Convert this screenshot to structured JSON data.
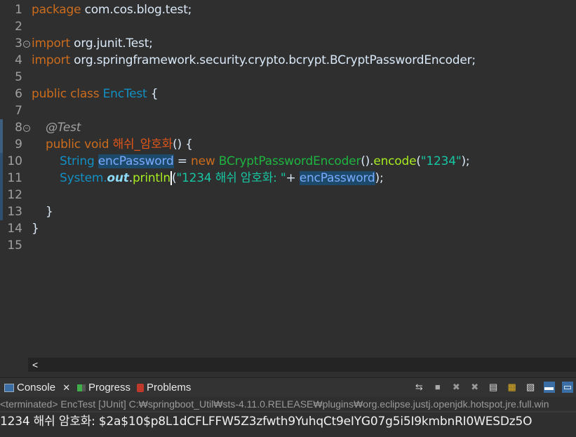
{
  "editor": {
    "line_numbers": [
      "1",
      "2",
      "3",
      "4",
      "5",
      "6",
      "7",
      "8",
      "9",
      "10",
      "11",
      "12",
      "13",
      "14",
      "15"
    ],
    "code": {
      "l1_kw": "package",
      "l1_rest": " com.cos.blog.test;",
      "l3_kw": "import",
      "l3_rest": " org.junit.Test;",
      "l4_kw": "import",
      "l4_rest": " org.springframework.security.crypto.bcrypt.BCryptPasswordEncoder;",
      "l6_kw": "public class",
      "l6_cls": "EncTest",
      "l6_rest": " {",
      "l8_ann": "@Test",
      "l9_kw": "public void",
      "l9_name": "해쉬_암호화",
      "l9_rest": "() {",
      "l10_type": "String",
      "l10_var": "encPassword",
      "l10_eq": " = ",
      "l10_new": "new",
      "l10_cls": "BCryptPasswordEncoder",
      "l10_p1": "().",
      "l10_mth": "encode",
      "l10_p2": "(",
      "l10_str": "\"1234\"",
      "l10_end": ");",
      "l11_cls": "System.",
      "l11_fld": "out",
      "l11_dot": ".",
      "l11_mth": "println",
      "l11_paren": "(",
      "l11_str": "\"1234 해쉬 암호화: \"",
      "l11_plus": "+ ",
      "l11_var": "encPassword",
      "l11_end": ");",
      "l13": "}",
      "l14": "}"
    },
    "scroll_left_label": "<"
  },
  "console": {
    "tabs": [
      {
        "label": "Console",
        "close": "✕"
      },
      {
        "label": "Progress"
      },
      {
        "label": "Problems"
      }
    ],
    "status": "<terminated> EncTest [JUnit] C:₩springboot_Util₩sts-4.11.0.RELEASE₩plugins₩org.eclipse.justj.openjdk.hotspot.jre.full.win",
    "output": "1234 해쉬 암호화: $2a$10$p8L1dCFLFFW5Z3zfwth9YuhqCt9eIYG07g5i5I9kmbnRI0WESDz5O"
  },
  "colors": {
    "editor_bg": "#2f2f2f",
    "keyword": "#cc6c1d",
    "type": "#1290c3",
    "class": "#1eb540",
    "method": "#a7ec21",
    "string": "#17c6a3"
  }
}
